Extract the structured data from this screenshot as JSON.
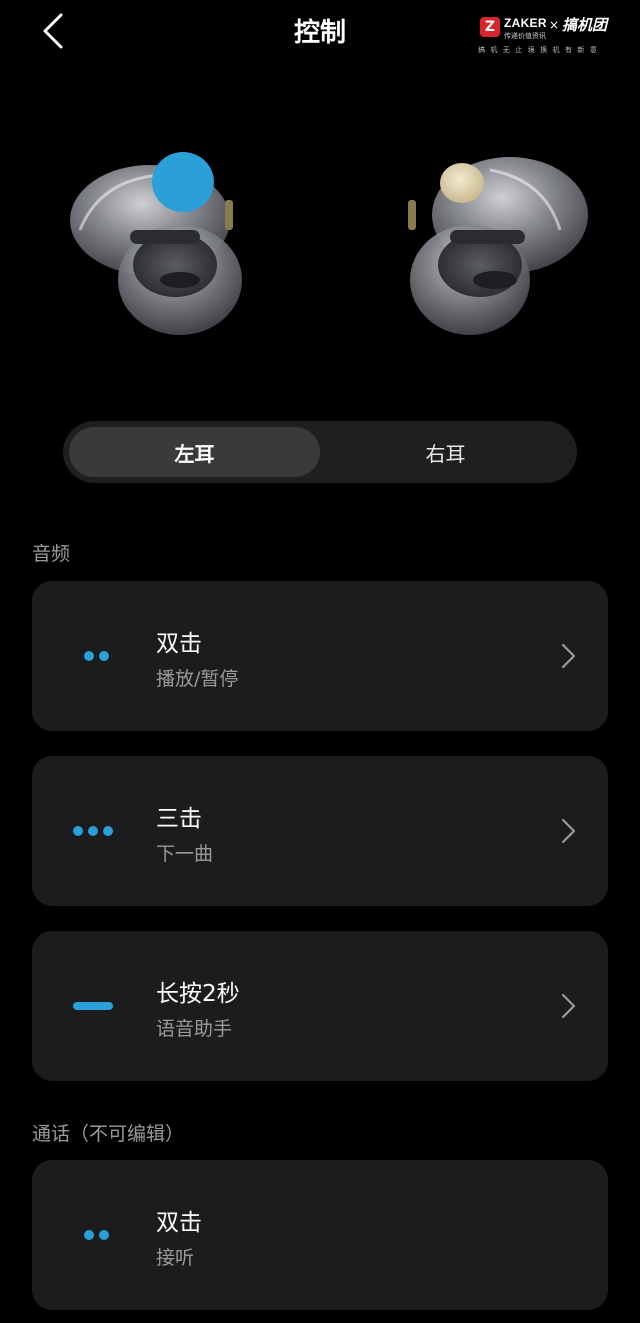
{
  "header": {
    "title": "控制",
    "back_icon": "chevron-left-icon"
  },
  "watermark": {
    "brand": "ZAKER",
    "brand_sub": "传递价值资讯",
    "x_mark": "×",
    "partner": "搞机团",
    "slogan": "搞 机 无 止 境   换 机 有 新 意"
  },
  "ear_selector": {
    "left_label": "左耳",
    "right_label": "右耳",
    "selected": "左耳"
  },
  "sections": {
    "audio_label": "音频",
    "call_label": "通话（不可编辑）"
  },
  "audio_items": [
    {
      "title": "双击",
      "action": "播放/暂停",
      "icon": "double-tap-icon"
    },
    {
      "title": "三击",
      "action": "下一曲",
      "icon": "triple-tap-icon"
    },
    {
      "title": "长按2秒",
      "action": "语音助手",
      "icon": "long-press-icon"
    }
  ],
  "call_items": [
    {
      "title": "双击",
      "action": "接听",
      "icon": "double-tap-icon"
    }
  ],
  "colors": {
    "accent": "#2a9fd8",
    "background": "#000000",
    "card": "#1c1c1e",
    "secondary_text": "#9a9a9a"
  }
}
